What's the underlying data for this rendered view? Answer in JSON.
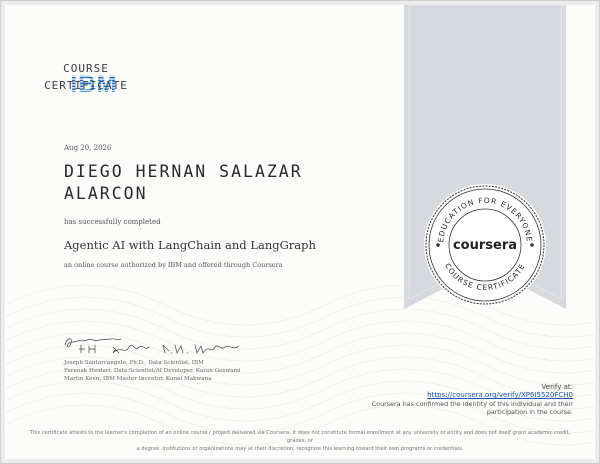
{
  "ribbon": {
    "title_line1": "COURSE",
    "title_line2": "CERTIFICATE",
    "color": "#d6d9de"
  },
  "logo": {
    "text": "IBM",
    "color": "#1f70c1"
  },
  "certificate": {
    "date": "Aug 20, 2026",
    "recipient_line1": "DIEGO HERNAN SALAZAR",
    "recipient_line2": "ALARCON",
    "completed_text": "has successfully completed",
    "course_title": "Agentic AI with LangChain and LangGraph",
    "authored_text": "an online course authorized by IBM and offered through Coursera"
  },
  "signatures": {
    "caption_line1": "Joseph Santarcangelo, Ph.D., Data Scientist, IBM",
    "caption_line2": "Faranak Heidari, Data Scientist/AI Developer, Karan Goswami",
    "caption_line3": "Martin Keen, IBM Master Inventor, Kunal Makwana"
  },
  "seal": {
    "brand": "coursera",
    "ring_top": "EDUCATION FOR EVERYONE",
    "ring_bottom": "COURSE CERTIFICATE"
  },
  "verify": {
    "label": "Verify at:",
    "url": "https://coursera.org/verify/XP6I5520FCH0",
    "note_line1": "Coursera has confirmed the identity of this individual and their",
    "note_line2": "participation in the course."
  },
  "disclaimer": {
    "line1": "This certificate attests to the learner's completion of an online course / project delivered via Coursera. It does not constitute formal enrollment at any university or entity and does not itself grant academic credit, grades, or",
    "line2": "a degree. Institutions or organizations may at their discretion, recognize this learning toward their own programs or credentials."
  }
}
